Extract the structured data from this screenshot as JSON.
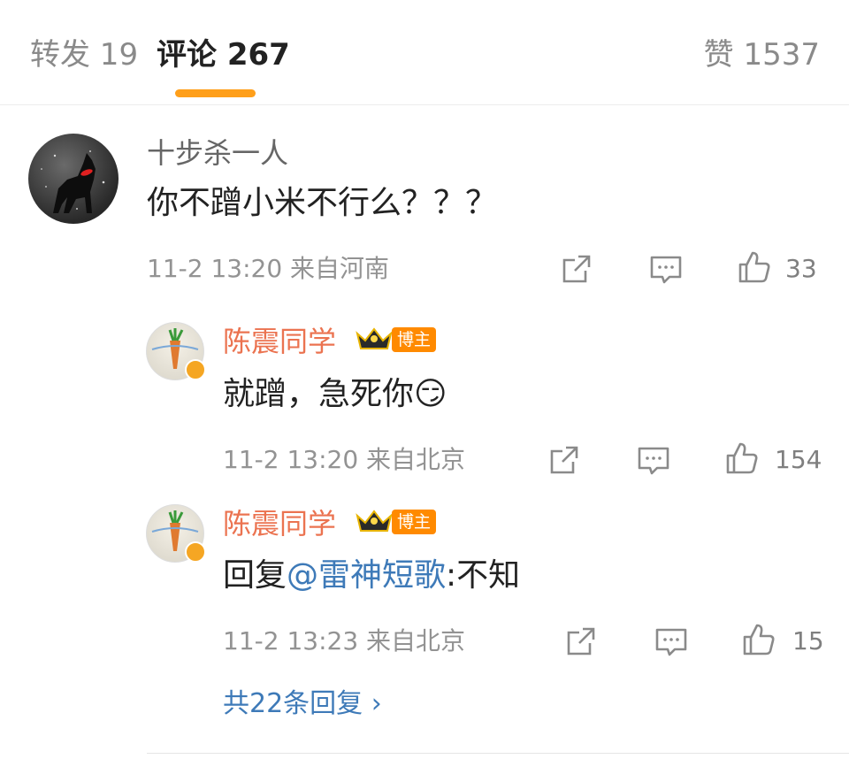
{
  "tabs": {
    "repost": "转发 19",
    "comment": "评论 267",
    "like": "赞 1537"
  },
  "comment": {
    "username": "十步杀一人",
    "text": "你不蹭小米不行么？？？",
    "meta": "11-2 13:20  来自河南",
    "likes": "33"
  },
  "replies": [
    {
      "username": "陈震同学",
      "badge_tag": "博主",
      "text": "就蹭，急死你",
      "emoji": "😏",
      "meta": "11-2 13:20  来自北京",
      "likes": "154"
    },
    {
      "username": "陈震同学",
      "badge_tag": "博主",
      "text_prefix": "回复",
      "mention": "@雷神短歌",
      "text_suffix": ":不知",
      "meta": "11-2 13:23  来自北京",
      "likes": "15"
    }
  ],
  "more_replies": "共22条回复 ›",
  "colors": {
    "accent": "#ff9f1a",
    "username_vip": "#eb7350",
    "link": "#3e7ab8"
  },
  "icons": [
    "share-icon",
    "comment-icon",
    "like-icon",
    "crown-icon"
  ]
}
